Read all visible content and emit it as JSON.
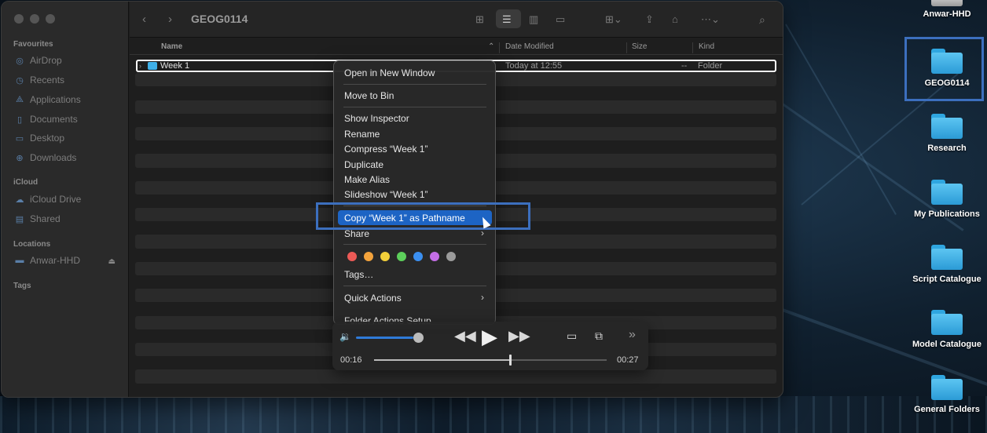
{
  "finder": {
    "title": "GEOG0114",
    "sidebar": {
      "sections": {
        "favourites": "Favourites",
        "icloud": "iCloud",
        "locations": "Locations",
        "tags": "Tags"
      },
      "items": {
        "airdrop": "AirDrop",
        "recents": "Recents",
        "applications": "Applications",
        "documents": "Documents",
        "desktop": "Desktop",
        "downloads": "Downloads",
        "icloud_drive": "iCloud Drive",
        "shared": "Shared",
        "anwar_hhd": "Anwar-HHD"
      }
    },
    "columns": {
      "name": "Name",
      "date_modified": "Date Modified",
      "size": "Size",
      "kind": "Kind"
    },
    "rows": [
      {
        "name": "Week 1",
        "date_modified": "Today at 12:55",
        "size": "--",
        "kind": "Folder"
      }
    ]
  },
  "context_menu": {
    "open_new_window": "Open in New Window",
    "move_to_bin": "Move to Bin",
    "show_inspector": "Show Inspector",
    "rename": "Rename",
    "compress": "Compress “Week 1”",
    "duplicate": "Duplicate",
    "make_alias": "Make Alias",
    "slideshow": "Slideshow “Week 1”",
    "copy_pathname": "Copy “Week 1” as Pathname",
    "share": "Share",
    "tags": "Tags…",
    "quick_actions": "Quick Actions",
    "folder_actions": "Folder Actions Setup",
    "tag_colors": [
      "#ec5a56",
      "#f3a33c",
      "#f2cf3a",
      "#5dcf5b",
      "#3b8ff0",
      "#c46ee6",
      "#9b9b9b"
    ]
  },
  "player": {
    "elapsed": "00:16",
    "remaining": "00:27",
    "progress_fraction": 0.58,
    "volume_fraction": 0.85
  },
  "desktop_icons": {
    "anwar_hhd": "Anwar-HHD",
    "geog0114": "GEOG0114",
    "research": "Research",
    "my_publications": "My Publications",
    "script_catalogue": "Script Catalogue",
    "model_catalogue": "Model Catalogue",
    "general_folders": "General Folders"
  }
}
